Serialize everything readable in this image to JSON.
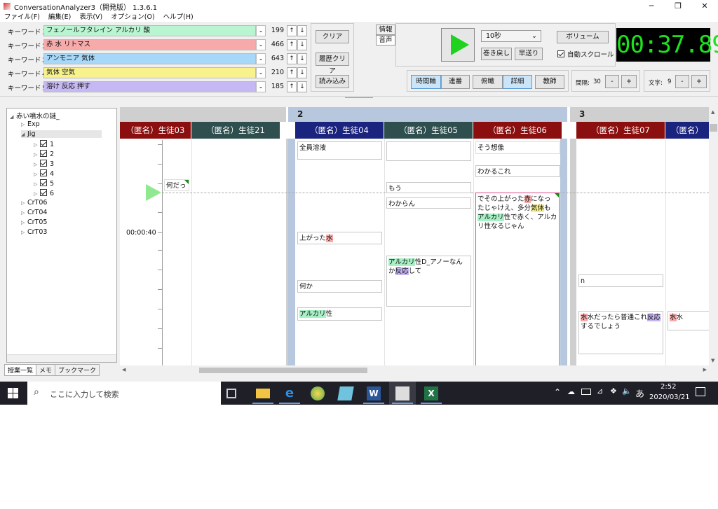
{
  "window": {
    "title": "ConversationAnalyzer3（開発版） 1.3.6.1",
    "controls": {
      "minimize": "─",
      "maximize": "❐",
      "close": "✕"
    }
  },
  "menu": [
    "ファイル(F)",
    "編集(E)",
    "表示(V)",
    "オプション(O)",
    "ヘルプ(H)"
  ],
  "keywords": [
    {
      "label": "キーワード１",
      "value": "フェノールフタレイン  アルカリ  酸",
      "count": "199",
      "color": "#b8f5d0"
    },
    {
      "label": "キーワード２",
      "value": "赤  水  リトマス",
      "count": "466",
      "color": "#f7aaaa"
    },
    {
      "label": "キーワード３",
      "value": "アンモニア  気体",
      "count": "643",
      "color": "#a8d8f7"
    },
    {
      "label": "キーワード４",
      "value": "気体  空気",
      "count": "210",
      "color": "#f7f28c"
    },
    {
      "label": "キーワード５",
      "value": "溶け  反応  押す",
      "count": "185",
      "color": "#c6b8f2"
    }
  ],
  "arrows": {
    "up": "↑",
    "down": "↓",
    "dropdown": "⌄"
  },
  "kwButtons": {
    "clear": "クリア",
    "historyClear": "履歴クリア",
    "load": "読み込み"
  },
  "sideTabs": {
    "info": "情報",
    "audio": "音声"
  },
  "playback": {
    "interval": "10秒",
    "rewind": "巻き戻し",
    "forward": "早送り",
    "volume": "ボリューム",
    "autoScroll": "自動スクロール",
    "time": "00:37.89"
  },
  "viewButtons": [
    "時間軸",
    "連番",
    "俯瞰",
    "詳細",
    "教師"
  ],
  "spacing": {
    "label": "間隔:",
    "value": "30",
    "minus": "-",
    "plus": "+"
  },
  "chars": {
    "label": "文字:",
    "value": "9",
    "minus": "-",
    "plus": "+"
  },
  "tree": {
    "root": "赤い噴水の謎_",
    "exp": "Exp",
    "jig": "Jig",
    "groups": [
      "1",
      "2",
      "3",
      "4",
      "5",
      "6"
    ],
    "others": [
      "CrT06",
      "CrT04",
      "CrT05",
      "CrT03"
    ]
  },
  "bottomTabs": [
    "授業一覧",
    "メモ",
    "ブックマーク"
  ],
  "timeline": {
    "groupLabels": [
      "2",
      "3"
    ],
    "timestamp": "00:00:40",
    "columns": [
      {
        "name": "（匿名）生徒03",
        "color": "#8b0f0f"
      },
      {
        "name": "（匿名）生徒21",
        "color": "#2f4f4f"
      },
      {
        "name": "（匿名）生徒04",
        "color": "#1a237e"
      },
      {
        "name": "（匿名）生徒05",
        "color": "#2f4f4f"
      },
      {
        "name": "（匿名）生徒06",
        "color": "#8b0f0f"
      },
      {
        "name": "（匿名）生徒07",
        "color": "#8b0f0f"
      },
      {
        "name": "（匿名）",
        "color": "#1a237e"
      }
    ],
    "messages": {
      "m03a": "何だっ",
      "m04a": "全員溶液",
      "m04b_pre": "上がった",
      "m04b_hl": "水",
      "m04c": "何か",
      "m04d_hl": "アルカリ",
      "m04d_post": "性",
      "m05a": "",
      "m05b": "もう",
      "m05c": "わからん",
      "m05d_hl1": "アルカリ",
      "m05d_mid": "性D_アノーなんか",
      "m05d_hl2": "反応",
      "m05d_post": "して",
      "m06a": "そう想像",
      "m06b": "わかるこれ",
      "m06c_1": "でその上がった",
      "m06c_h1": "赤",
      "m06c_2": "になったじゃけえ、多分",
      "m06c_h2": "気体",
      "m06c_3": "も",
      "m06c_h3": "アルカリ",
      "m06c_4": "性で赤く、アルカリ性なるじゃん",
      "m07a": "n",
      "m07b_h1": "水",
      "m07b_1": "水だったら普通これ",
      "m07b_h2": "反応",
      "m07b_2": "するでしょう",
      "m08a_h": "水",
      "m08a_post": "水"
    }
  },
  "taskbar": {
    "searchPlaceholder": "ここに入力して検索",
    "time": "2:52",
    "date": "2020/03/21",
    "ime": "あ",
    "word": "W",
    "excel": "X"
  }
}
